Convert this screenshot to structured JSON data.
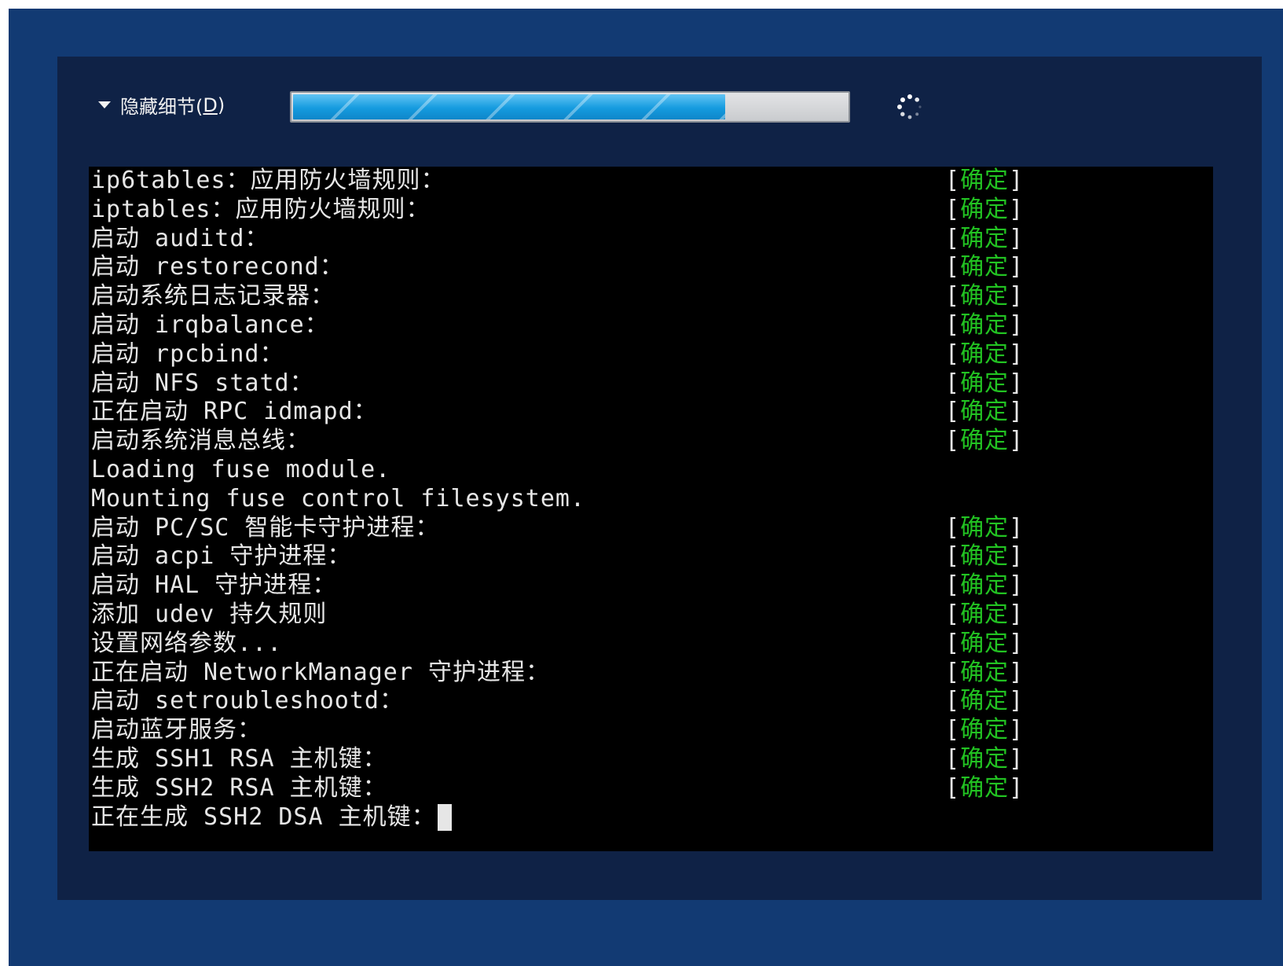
{
  "details_toggle": {
    "label": "隐藏细节(",
    "mnemonic": "D",
    "suffix": ")",
    "icon": "triangle-down-icon"
  },
  "progress": {
    "value_percent": 78
  },
  "spinner": {
    "icon": "loading-spinner-icon"
  },
  "colors": {
    "outer_background": "#123a73",
    "panel_background": "#0f2246",
    "terminal_background": "#000000",
    "ok_text": "#22c322",
    "progress_fill": "#159bdf"
  },
  "console": {
    "status_open": "[",
    "status_close": "]",
    "lines": [
      {
        "text": "ip6tables：应用防火墙规则：",
        "status": "确定"
      },
      {
        "text": "iptables：应用防火墙规则：",
        "status": "确定"
      },
      {
        "text": "启动 auditd：",
        "status": "确定"
      },
      {
        "text": "启动 restorecond：",
        "status": "确定"
      },
      {
        "text": "启动系统日志记录器：",
        "status": "确定"
      },
      {
        "text": "启动 irqbalance：",
        "status": "确定"
      },
      {
        "text": "启动 rpcbind：",
        "status": "确定"
      },
      {
        "text": "启动 NFS statd：",
        "status": "确定"
      },
      {
        "text": "正在启动 RPC idmapd：",
        "status": "确定"
      },
      {
        "text": "启动系统消息总线：",
        "status": "确定"
      },
      {
        "text": "Loading fuse module.",
        "status": ""
      },
      {
        "text": "Mounting fuse control filesystem.",
        "status": ""
      },
      {
        "text": "启动 PC/SC 智能卡守护进程：",
        "status": "确定"
      },
      {
        "text": "启动 acpi 守护进程：",
        "status": "确定"
      },
      {
        "text": "启动 HAL 守护进程：",
        "status": "确定"
      },
      {
        "text": "添加 udev 持久规则",
        "status": "确定"
      },
      {
        "text": "设置网络参数...",
        "status": "确定"
      },
      {
        "text": "正在启动 NetworkManager 守护进程：",
        "status": "确定"
      },
      {
        "text": "启动 setroubleshootd：",
        "status": "确定"
      },
      {
        "text": "启动蓝牙服务：",
        "status": "确定"
      },
      {
        "text": "生成 SSH1 RSA 主机键：",
        "status": "确定"
      },
      {
        "text": "生成 SSH2 RSA 主机键：",
        "status": "确定"
      },
      {
        "text": "正在生成 SSH2 DSA 主机键：",
        "status": "",
        "cursor": true
      }
    ]
  }
}
